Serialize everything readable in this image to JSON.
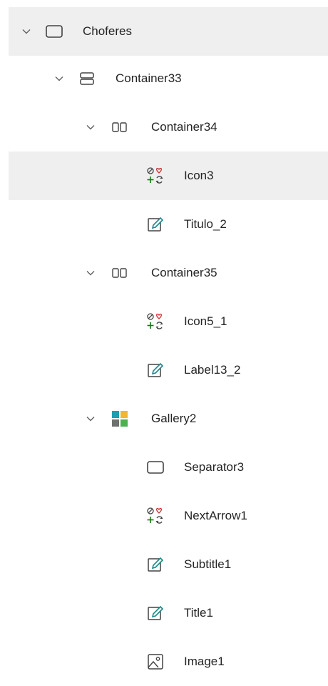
{
  "tree": {
    "items": [
      {
        "label": "Choferes",
        "icon": "screen-icon"
      },
      {
        "label": "Container33",
        "icon": "vertical-container-icon"
      },
      {
        "label": "Container34",
        "icon": "horizontal-container-icon"
      },
      {
        "label": "Icon3",
        "icon": "icon-control-icon"
      },
      {
        "label": "Titulo_2",
        "icon": "edit-label-icon"
      },
      {
        "label": "Container35",
        "icon": "horizontal-container-icon"
      },
      {
        "label": "Icon5_1",
        "icon": "icon-control-icon"
      },
      {
        "label": "Label13_2",
        "icon": "edit-label-icon"
      },
      {
        "label": "Gallery2",
        "icon": "gallery-icon"
      },
      {
        "label": "Separator3",
        "icon": "rectangle-icon"
      },
      {
        "label": "NextArrow1",
        "icon": "icon-control-icon"
      },
      {
        "label": "Subtitle1",
        "icon": "edit-label-icon"
      },
      {
        "label": "Title1",
        "icon": "edit-label-icon"
      },
      {
        "label": "Image1",
        "icon": "image-icon"
      }
    ],
    "colors": {
      "selected_bg": "#efefef",
      "text": "#242424",
      "accent_teal": "#1a8a8a",
      "icon_red": "#d13438",
      "icon_green": "#107c10"
    }
  }
}
